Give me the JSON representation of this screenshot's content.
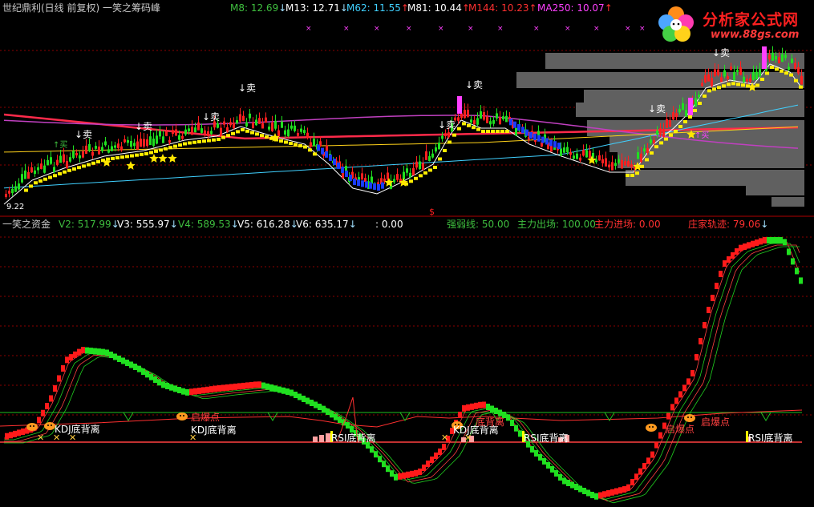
{
  "top_header": {
    "title": "世纪鼎利(日线 前复权) 一笑之筹码峰",
    "indicators": [
      {
        "label": "M8: 12.69",
        "arrow": "↓",
        "color": "#3fbf3f"
      },
      {
        "label": "M13: 12.71",
        "arrow": "↓",
        "color": "#ffffff"
      },
      {
        "label": "M62: 11.55",
        "arrow": "↑",
        "color": "#40d0ff"
      },
      {
        "label": "M81: 10.44",
        "arrow": "↑",
        "color": "#ffffff"
      },
      {
        "label": "M144: 10.23",
        "arrow": "↑",
        "color": "#ff3030"
      },
      {
        "label": "MA250: 10.07",
        "arrow": "↑",
        "color": "#ff40ff"
      }
    ]
  },
  "logo": {
    "title": "分析家公式网",
    "url": "www.88gs.com"
  },
  "price_panel": {
    "sell_label": "↓卖",
    "buy_label": "↑买",
    "low_price_label": "9.22",
    "dollar_marker": "$"
  },
  "mid_header": {
    "title": "一笑之资金",
    "indicators": [
      {
        "label": "V2: 517.99",
        "arrow": "↓",
        "color": "#3fbf3f"
      },
      {
        "label": "V3: 555.97",
        "arrow": "↓",
        "color": "#ffffff"
      },
      {
        "label": "V4: 589.53",
        "arrow": "↓",
        "color": "#3fbf3f"
      },
      {
        "label": "V5: 616.28",
        "arrow": "↓",
        "color": "#ffffff"
      },
      {
        "label": "V6: 635.17",
        "arrow": "↓",
        "color": "#ffffff"
      },
      {
        "label": ": 0.00",
        "arrow": "",
        "color": "#ffffff"
      },
      {
        "label": "强弱线: 50.00",
        "arrow": "",
        "color": "#3fbf3f"
      },
      {
        "label": "主力出场: 100.00",
        "arrow": "",
        "color": "#3fbf3f"
      },
      {
        "label": "主力进场: 0.00",
        "arrow": "",
        "color": "#ff3030"
      },
      {
        "label": "庄家轨迹: 79.06",
        "arrow": "↓",
        "color": "#ff3030"
      }
    ]
  },
  "bottom_annotations": {
    "kdj_divergence": "KDJ底背离",
    "rsi_divergence": "RSI底背离",
    "start_point": "启爆点",
    "divergence_partial": "底背离"
  },
  "colors": {
    "up": "#ff2020",
    "down": "#20e020",
    "grid": "#8b0000",
    "volume_bars": "#606060",
    "ma_purple": "#c040c0",
    "ma_cyan": "#40d0ff"
  }
}
